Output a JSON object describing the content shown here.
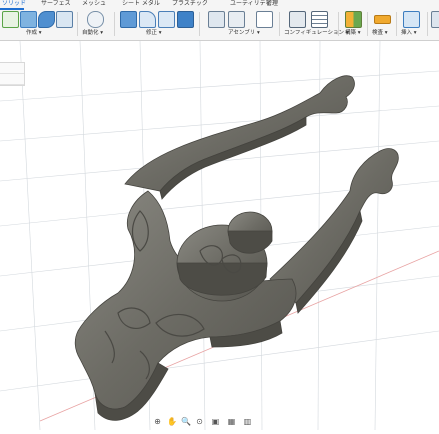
{
  "tabs": [
    {
      "label": "ソリッド",
      "active": true
    },
    {
      "label": "サーフェス"
    },
    {
      "label": "メッシュ"
    },
    {
      "label": "シート メタル"
    },
    {
      "label": "プラスチック"
    },
    {
      "label": "ユーティリティ"
    },
    {
      "label": "管理"
    }
  ],
  "groups": {
    "create": "作成 ▾",
    "automate": "自動化 ▾",
    "modify": "修正 ▾",
    "assemble": "アセンブリ ▾",
    "configure": "コンフィギュレーション ▾",
    "construct": "構築 ▾",
    "inspect": "検査 ▾",
    "insert": "挿入 ▾"
  },
  "icons": [
    "new-component-icon",
    "extrude-icon",
    "revolve-icon",
    "hole-icon",
    "automate-icon",
    "press-pull-icon",
    "fillet-icon",
    "chamfer-icon",
    "shell-icon",
    "joint-icon",
    "as-built-joint-icon",
    "configure-icon",
    "table-icon",
    "offset-plane-icon",
    "measure-icon",
    "insert-icon"
  ],
  "colors": {
    "accent": "#1f6fd1",
    "model": "#6a6963",
    "grid": "#c9ced4"
  },
  "navbar": [
    "⊕",
    "✋",
    "🔍",
    "⊙",
    "▣",
    "▦",
    "▥"
  ]
}
